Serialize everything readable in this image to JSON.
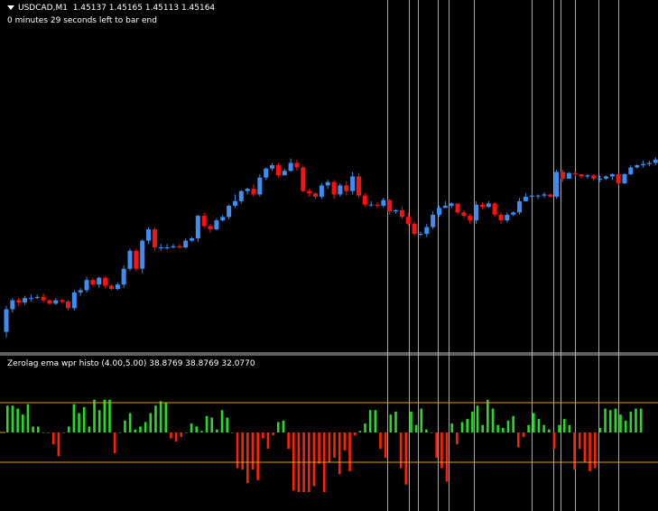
{
  "header": {
    "symbol": "USDCAD,M1",
    "ohlc": "1.45137 1.45165 1.45113 1.45164",
    "countdown": "0 minutes 29 seconds left to bar end"
  },
  "indicator": {
    "label": "Zerolag ema wpr histo (4.00,5.00) 38.8769 38.8769 32.0770"
  },
  "colors": {
    "background": "#000000",
    "bull": "#3d8ef2",
    "bear": "#ff1010",
    "histo_up": "#22dd22",
    "histo_down": "#ff2200",
    "vline": "#f0c070",
    "level": "#e0a000",
    "separator": "#c0c0c0"
  },
  "chart_data": [
    {
      "type": "candlestick",
      "series": [
        {
          "name": "USDCAD,M1",
          "ohlc": [
            [
              10,
              30,
              5,
              33
            ],
            [
              30,
              38,
              27,
              40
            ],
            [
              38,
              36,
              33,
              40
            ],
            [
              36,
              40,
              34,
              42
            ],
            [
              40,
              40,
              37,
              43
            ],
            [
              40,
              41,
              39,
              43
            ],
            [
              41,
              38,
              36,
              44
            ],
            [
              38,
              35,
              34,
              39
            ],
            [
              35,
              38,
              34,
              40
            ],
            [
              38,
              37,
              35,
              39
            ],
            [
              37,
              31,
              29,
              38
            ],
            [
              31,
              45,
              29,
              47
            ],
            [
              45,
              47,
              42,
              49
            ],
            [
              47,
              56,
              45,
              59
            ],
            [
              56,
              52,
              50,
              58
            ],
            [
              52,
              58,
              49,
              59
            ],
            [
              58,
              51,
              49,
              59
            ],
            [
              51,
              48,
              47,
              52
            ],
            [
              48,
              52,
              47,
              54
            ],
            [
              52,
              66,
              49,
              69
            ],
            [
              66,
              82,
              64,
              84
            ],
            [
              82,
              66,
              64,
              84
            ],
            [
              66,
              91,
              62,
              92
            ],
            [
              91,
              101,
              88,
              103
            ],
            [
              101,
              85,
              82,
              103
            ],
            [
              85,
              85,
              82,
              88
            ],
            [
              85,
              85,
              83,
              88
            ],
            [
              85,
              86,
              84,
              88
            ],
            [
              86,
              85,
              84,
              88
            ],
            [
              85,
              91,
              84,
              93
            ],
            [
              91,
              93,
              90,
              94
            ],
            [
              93,
              113,
              90,
              114
            ],
            [
              113,
              104,
              102,
              116
            ],
            [
              104,
              101,
              98,
              106
            ],
            [
              101,
              109,
              100,
              111
            ],
            [
              109,
              112,
              108,
              114
            ],
            [
              112,
              122,
              110,
              123
            ],
            [
              122,
              126,
              120,
              132
            ],
            [
              126,
              135,
              124,
              136
            ],
            [
              135,
              137,
              132,
              138
            ],
            [
              137,
              132,
              130,
              141
            ],
            [
              132,
              147,
              130,
              150
            ],
            [
              147,
              155,
              145,
              156
            ],
            [
              155,
              158,
              153,
              160
            ],
            [
              158,
              149,
              147,
              160
            ],
            [
              149,
              153,
              151,
              155
            ],
            [
              153,
              160,
              152,
              164
            ],
            [
              160,
              156,
              153,
              163
            ],
            [
              156,
              135,
              134,
              158
            ],
            [
              135,
              133,
              130,
              137
            ],
            [
              133,
              130,
              128,
              134
            ],
            [
              130,
              140,
              128,
              142
            ],
            [
              140,
              143,
              137,
              145
            ],
            [
              143,
              132,
              128,
              145
            ],
            [
              132,
              140,
              130,
              142
            ],
            [
              140,
              135,
              131,
              144
            ],
            [
              135,
              148,
              132,
              152
            ],
            [
              148,
              131,
              129,
              151
            ],
            [
              131,
              123,
              121,
              133
            ],
            [
              123,
              123,
              121,
              126
            ],
            [
              123,
              122,
              120,
              125
            ],
            [
              122,
              127,
              120,
              129
            ],
            [
              127,
              117,
              114,
              128
            ],
            [
              117,
              118,
              115,
              119
            ],
            [
              118,
              112,
              110,
              121
            ],
            [
              112,
              106,
              104,
              116
            ],
            [
              106,
              97,
              95,
              108
            ],
            [
              97,
              97,
              95,
              99
            ],
            [
              97,
              103,
              94,
              106
            ],
            [
              103,
              114,
              101,
              117
            ],
            [
              114,
              120,
              112,
              122
            ],
            [
              120,
              122,
              120,
              126
            ],
            [
              122,
              124,
              120,
              125
            ],
            [
              124,
              116,
              114,
              124
            ],
            [
              116,
              113,
              111,
              118
            ],
            [
              113,
              109,
              106,
              115
            ],
            [
              109,
              123,
              106,
              126
            ],
            [
              123,
              121,
              119,
              125
            ],
            [
              121,
              124,
              120,
              126
            ],
            [
              124,
              114,
              112,
              125
            ],
            [
              114,
              109,
              106,
              116
            ],
            [
              109,
              114,
              107,
              116
            ],
            [
              114,
              116,
              113,
              117
            ],
            [
              116,
              126,
              114,
              129
            ],
            [
              126,
              130,
              126,
              133
            ],
            [
              130,
              131,
              129,
              133
            ],
            [
              131,
              131,
              128,
              132
            ],
            [
              131,
              132,
              129,
              134
            ],
            [
              132,
              130,
              129,
              133
            ],
            [
              130,
              152,
              128,
              154
            ],
            [
              152,
              146,
              143,
              154
            ],
            [
              146,
              151,
              146,
              152
            ],
            [
              151,
              150,
              148,
              152
            ],
            [
              150,
              148,
              146,
              149
            ],
            [
              148,
              149,
              146,
              150
            ],
            [
              149,
              146,
              144,
              150
            ],
            [
              146,
              146,
              143,
              149
            ],
            [
              146,
              148,
              145,
              149
            ],
            [
              148,
              150,
              145,
              151
            ],
            [
              150,
              142,
              140,
              151
            ],
            [
              142,
              150,
              141,
              151
            ],
            [
              150,
              156,
              149,
              158
            ],
            [
              156,
              158,
              155,
              159
            ],
            [
              158,
              159,
              156,
              162
            ],
            [
              159,
              160,
              157,
              162
            ],
            [
              160,
              163,
              158,
              165
            ],
            [
              163,
              164,
              161,
              166
            ]
          ]
        }
      ]
    },
    {
      "type": "bar",
      "title": "Zerolag ema wpr histo (4.00,5.00) 38.8769 38.8769 32.0770",
      "ylim": [
        -50,
        50
      ],
      "levels": [
        20,
        -20
      ],
      "series": [
        {
          "name": "histo",
          "values": [
            18,
            18,
            16,
            12,
            19,
            4,
            4,
            0,
            0,
            -8,
            -16,
            0,
            4,
            19,
            13,
            17,
            4,
            22,
            15,
            22,
            22,
            -14,
            0,
            8,
            13,
            2,
            4,
            7,
            13,
            18,
            21,
            20,
            -4,
            -6,
            -3,
            0,
            6,
            4,
            1,
            11,
            10,
            2,
            15,
            10,
            0,
            -24,
            -25,
            -34,
            -25,
            -32,
            -4,
            -11,
            -2,
            7,
            8,
            -11,
            -39,
            -40,
            -40,
            -40,
            -36,
            -21,
            -40,
            -20,
            -17,
            -28,
            -12,
            -26,
            -2,
            1,
            6,
            15,
            15,
            -11,
            -17,
            12,
            14,
            -24,
            -35,
            14,
            5,
            16,
            2,
            0,
            -17,
            -24,
            -33,
            6,
            -8,
            7,
            9,
            14,
            18,
            5,
            22,
            16,
            5,
            3,
            8,
            11,
            -10,
            -3,
            5,
            13,
            9,
            5,
            2,
            -11,
            5,
            9,
            5,
            -25,
            -11,
            -20,
            -26,
            -24,
            3,
            16,
            15,
            16,
            12,
            8,
            14,
            16,
            16
          ]
        }
      ]
    }
  ]
}
